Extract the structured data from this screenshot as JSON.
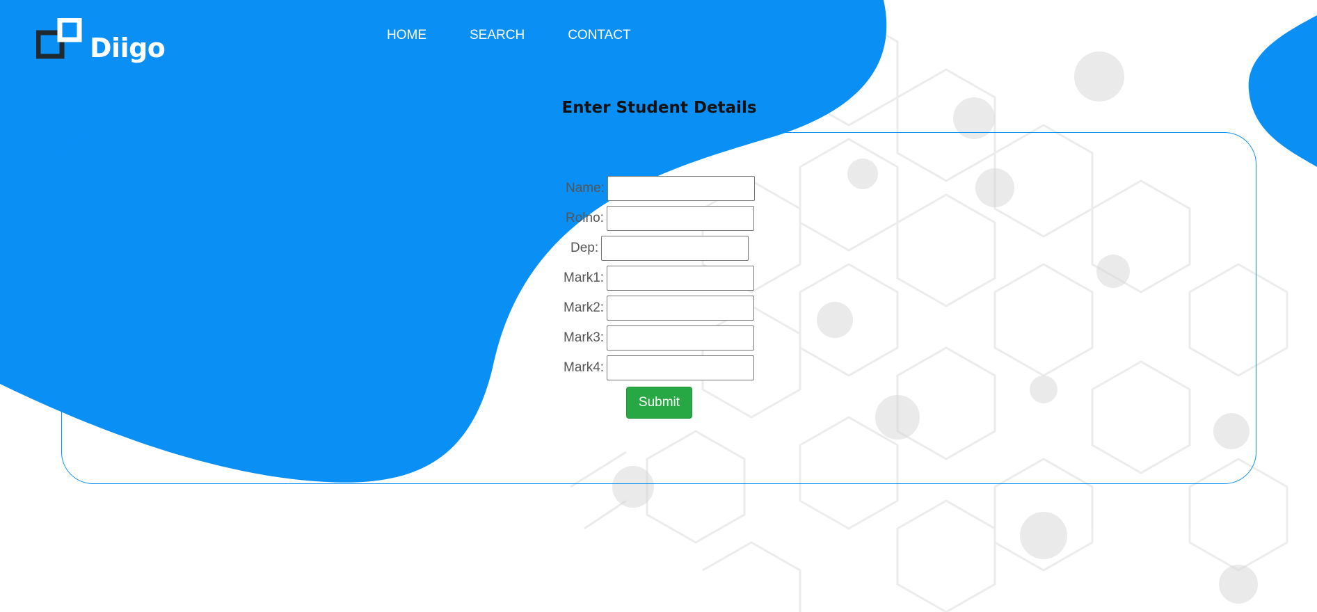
{
  "brand": {
    "name": "Diigo",
    "colors": {
      "blue": "#0a8ff5",
      "dark": "#1f2a30",
      "green": "#28a745"
    }
  },
  "nav": {
    "items": [
      {
        "label": "HOME"
      },
      {
        "label": "SEARCH"
      },
      {
        "label": "CONTACT"
      }
    ]
  },
  "form": {
    "title": "Enter Student Details",
    "fields": [
      {
        "label": "Name:",
        "value": ""
      },
      {
        "label": "Rolno:",
        "value": ""
      },
      {
        "label": "Dep:",
        "value": ""
      },
      {
        "label": "Mark1:",
        "value": ""
      },
      {
        "label": "Mark2:",
        "value": ""
      },
      {
        "label": "Mark3:",
        "value": ""
      },
      {
        "label": "Mark4:",
        "value": ""
      }
    ],
    "submit_label": "Submit"
  },
  "icons": {
    "logo": "squares-logo-icon"
  }
}
